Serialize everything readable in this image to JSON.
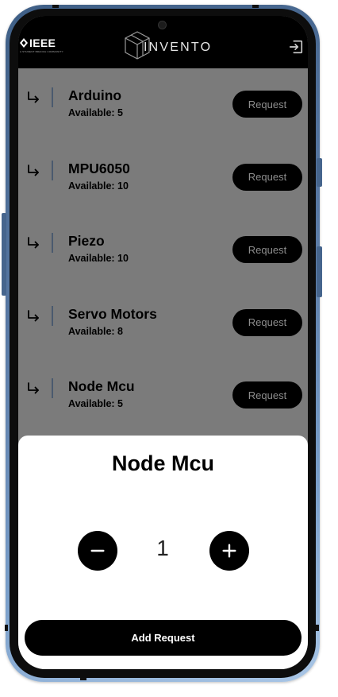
{
  "header": {
    "org_logo": "IEEE",
    "org_tagline": "A STUDENT BRANCH COMMUNITY",
    "app_name": "INVENTO",
    "logout_icon": "logout-icon"
  },
  "components": [
    {
      "name": "Arduino",
      "availability": "Available: 5",
      "request_label": "Request"
    },
    {
      "name": "MPU6050",
      "availability": "Available: 10",
      "request_label": "Request"
    },
    {
      "name": "Piezo",
      "availability": "Available: 10",
      "request_label": "Request"
    },
    {
      "name": "Servo Motors",
      "availability": "Available: 8",
      "request_label": "Request"
    },
    {
      "name": "Node Mcu",
      "availability": "Available: 5",
      "request_label": "Request"
    }
  ],
  "sheet": {
    "title": "Node Mcu",
    "quantity": "1",
    "decrement_icon": "minus-icon",
    "increment_icon": "plus-icon",
    "submit_label": "Add Request"
  },
  "colors": {
    "scrim": "#7b7b7b",
    "header_bg": "#000000",
    "button_bg": "#000000",
    "request_text": "#8d8d8d",
    "sheet_bg": "#ffffff",
    "phone_frame": "#5878a3"
  }
}
